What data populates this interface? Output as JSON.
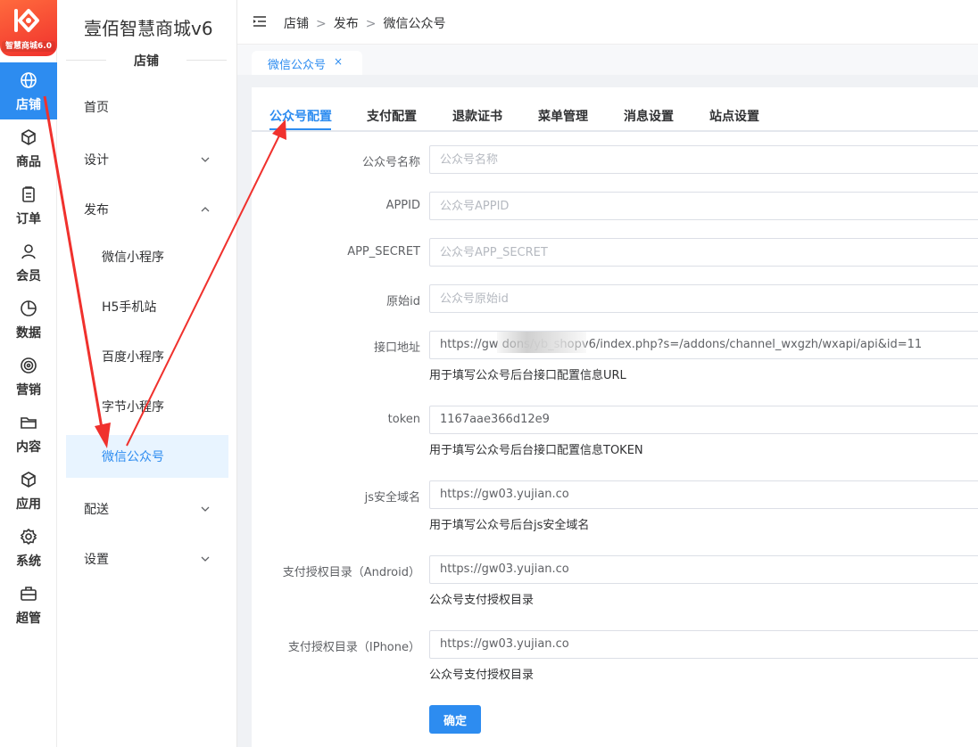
{
  "logo": {
    "tag": "智慧商城6.0"
  },
  "rail": [
    {
      "label": "店铺",
      "icon": "globe-icon"
    },
    {
      "label": "商品",
      "icon": "cube-icon"
    },
    {
      "label": "订单",
      "icon": "clipboard-icon"
    },
    {
      "label": "会员",
      "icon": "user-icon"
    },
    {
      "label": "数据",
      "icon": "pie-chart-icon"
    },
    {
      "label": "营销",
      "icon": "target-icon"
    },
    {
      "label": "内容",
      "icon": "folder-icon"
    },
    {
      "label": "应用",
      "icon": "box-icon"
    },
    {
      "label": "系统",
      "icon": "gear-icon"
    },
    {
      "label": "超管",
      "icon": "briefcase-icon"
    }
  ],
  "menu": {
    "app_title": "壹佰智慧商城v6",
    "section": "店铺",
    "items": [
      {
        "label": "首页"
      },
      {
        "label": "设计"
      },
      {
        "label": "发布"
      },
      {
        "label": "微信小程序"
      },
      {
        "label": "H5手机站"
      },
      {
        "label": "百度小程序"
      },
      {
        "label": "字节小程序"
      },
      {
        "label": "微信公众号"
      },
      {
        "label": "配送"
      },
      {
        "label": "设置"
      }
    ]
  },
  "breadcrumb": {
    "a": "店铺",
    "b": "发布",
    "c": "微信公众号",
    "sep": ">"
  },
  "page_tab": {
    "label": "微信公众号",
    "close": "×"
  },
  "content_tabs": [
    "公众号配置",
    "支付配置",
    "退款证书",
    "菜单管理",
    "消息设置",
    "站点设置"
  ],
  "form": {
    "name": {
      "label": "公众号名称",
      "placeholder": "公众号名称",
      "value": ""
    },
    "appid": {
      "label": "APPID",
      "placeholder": "公众号APPID",
      "value": ""
    },
    "secret": {
      "label": "APP_SECRET",
      "placeholder": "公众号APP_SECRET",
      "value": ""
    },
    "origin_id": {
      "label": "原始id",
      "placeholder": "公众号原始id",
      "value": ""
    },
    "api_url": {
      "label": "接口地址",
      "value": "https://gw                          dons/yb_shopv6/index.php?s=/addons/channel_wxgzh/wxapi/api&id=11",
      "hint": "用于填写公众号后台接口配置信息URL"
    },
    "token": {
      "label": "token",
      "value": "1167aae366d12e9",
      "hint": "用于填写公众号后台接口配置信息TOKEN"
    },
    "js_domain": {
      "label": "js安全域名",
      "value": "https://gw03.yujian.co",
      "hint": "用于填写公众号后台js安全域名"
    },
    "pay_android": {
      "label": "支付授权目录（Android）",
      "value": "https://gw03.yujian.co",
      "hint": "公众号支付授权目录"
    },
    "pay_iphone": {
      "label": "支付授权目录（IPhone）",
      "value": "https://gw03.yujian.co",
      "hint": "公众号支付授权目录"
    },
    "submit": "确定"
  },
  "colors": {
    "primary": "#2d8cf0",
    "annotation": "#f0312d"
  }
}
